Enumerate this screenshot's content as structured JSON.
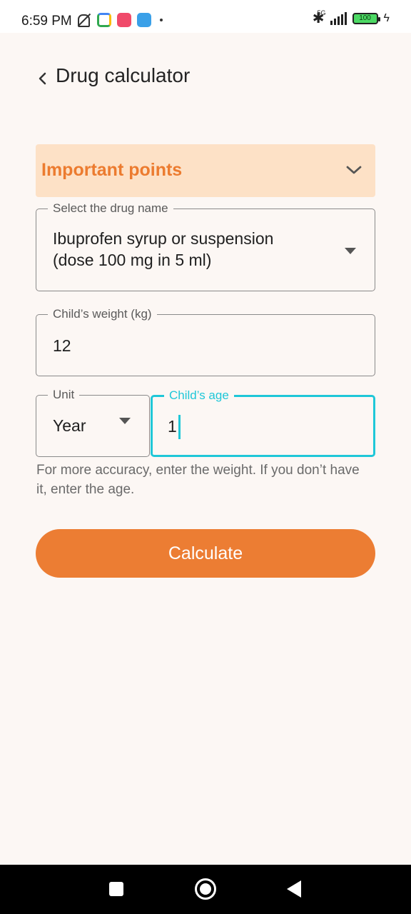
{
  "status_bar": {
    "time": "6:59 PM",
    "network": "5G",
    "battery": "100",
    "icons": [
      "mute-icon",
      "meet-icon",
      "app-icon",
      "upload-icon",
      "dot-icon",
      "bluetooth-icon",
      "signal-icon",
      "battery-icon",
      "charging-icon"
    ]
  },
  "header": {
    "title": "Drug calculator",
    "back_icon": "chevron-left-icon"
  },
  "important": {
    "label": "Important points",
    "icon": "chevron-down-icon",
    "bg_color": "#fde1c6",
    "text_color": "#ec7b2f"
  },
  "drug_field": {
    "label": "Select the drug name",
    "value_line1": "Ibuprofen syrup or suspension",
    "value_line2": "(dose 100 mg in 5 ml)"
  },
  "weight_field": {
    "label": "Child’s weight (kg)",
    "value": "12"
  },
  "unit_field": {
    "label": "Unit",
    "value": "Year"
  },
  "age_field": {
    "label": "Child’s age",
    "value": "1",
    "focus_color": "#1fc7d8"
  },
  "helper_text": "For more accuracy, enter the weight. If you don’t have it, enter the age.",
  "calculate_button": {
    "label": "Calculate",
    "color": "#ec7d33"
  },
  "nav_bar": {
    "icons": [
      "recents-icon",
      "home-icon",
      "back-icon"
    ]
  }
}
